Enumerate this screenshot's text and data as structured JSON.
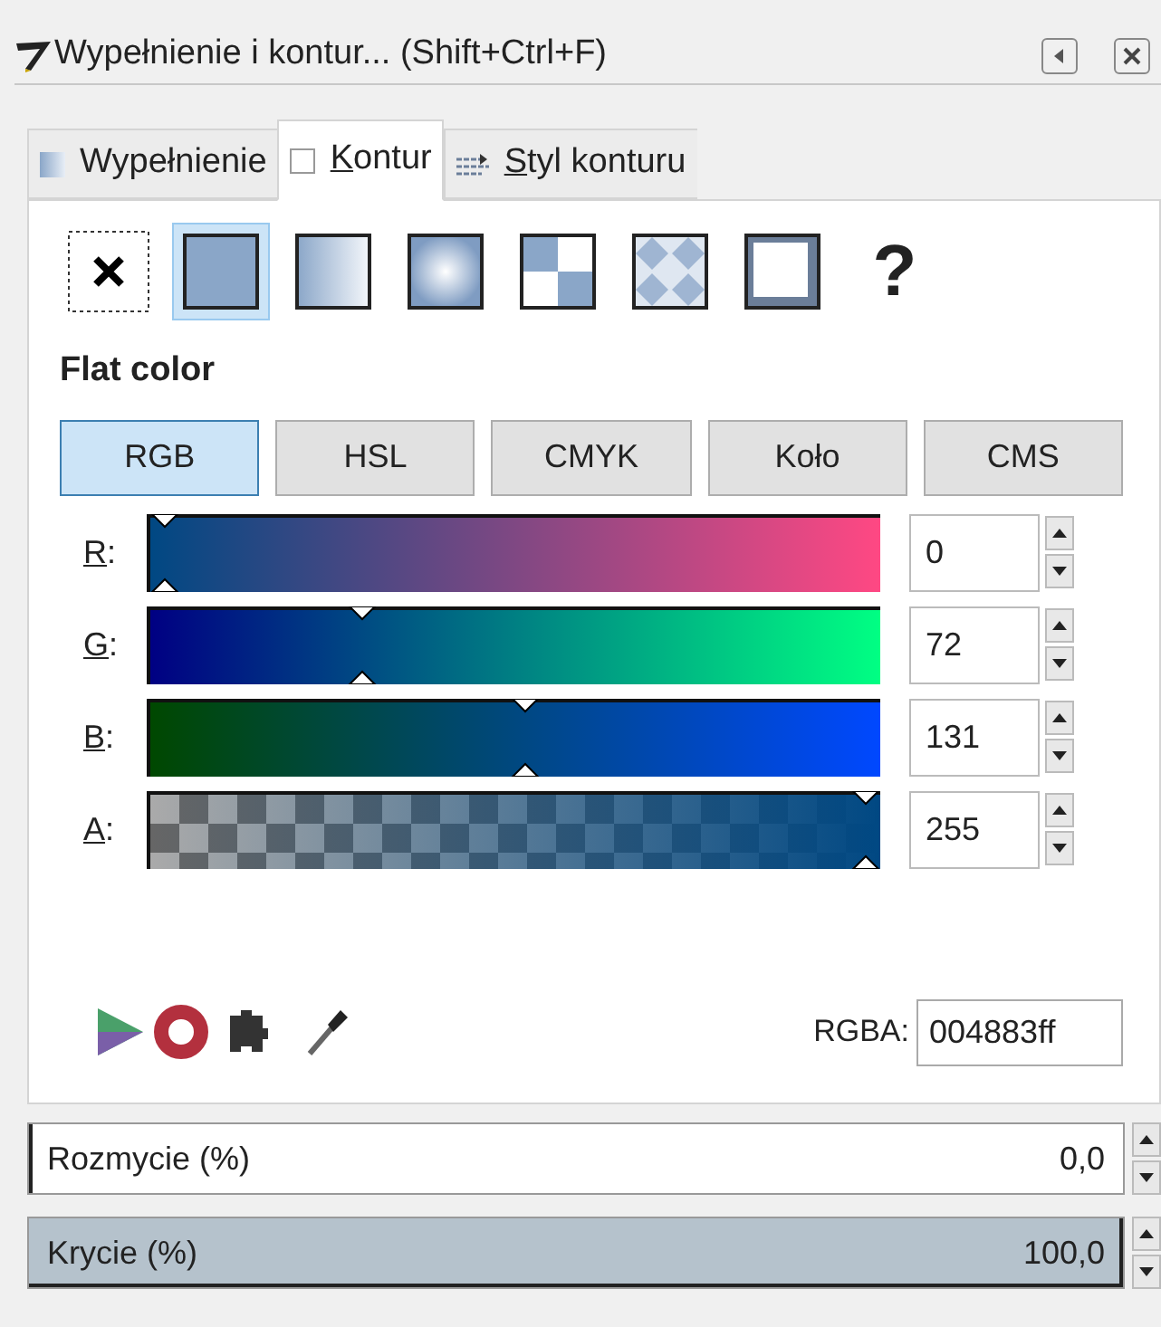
{
  "window": {
    "title": "Wypełnienie i kontur... (Shift+Ctrl+F)"
  },
  "tabs": [
    {
      "label": "Wypełnienie",
      "kind": "fill",
      "selected": false,
      "mnemonic": false
    },
    {
      "label": "Kontur",
      "kind": "stroke",
      "selected": true,
      "mnemonic": true
    },
    {
      "label": "Styl konturu",
      "kind": "style",
      "selected": false,
      "mnemonic": true
    }
  ],
  "paint_types": [
    {
      "kind": "none",
      "selected": false
    },
    {
      "kind": "flat",
      "selected": true
    },
    {
      "kind": "linear",
      "selected": false
    },
    {
      "kind": "radial",
      "selected": false
    },
    {
      "kind": "pattern",
      "selected": false
    },
    {
      "kind": "swatch",
      "selected": false
    },
    {
      "kind": "unset",
      "selected": false
    },
    {
      "kind": "unknown",
      "label": "?",
      "selected": false
    }
  ],
  "section_title": "Flat color",
  "modes": [
    {
      "label": "RGB",
      "selected": true
    },
    {
      "label": "HSL",
      "selected": false
    },
    {
      "label": "CMYK",
      "selected": false
    },
    {
      "label": "Koło",
      "selected": false
    },
    {
      "label": "CMS",
      "selected": false
    }
  ],
  "sliders": [
    {
      "label": "R:",
      "kind": "r",
      "level": 0,
      "value": "0"
    },
    {
      "label": "G:",
      "kind": "g",
      "level": 0.282,
      "value": "72"
    },
    {
      "label": "B:",
      "kind": "b",
      "level": 0.514,
      "value": "131"
    },
    {
      "label": "A:",
      "kind": "a",
      "level": 1,
      "value": "255"
    }
  ],
  "rgba": {
    "label": "RGBA:",
    "value": "004883ff"
  },
  "fields": [
    {
      "label": "Rozmycie (%)",
      "value": "0,0",
      "level": 0
    },
    {
      "label": "Krycie (%)",
      "value": "100,0",
      "level": 1
    }
  ]
}
